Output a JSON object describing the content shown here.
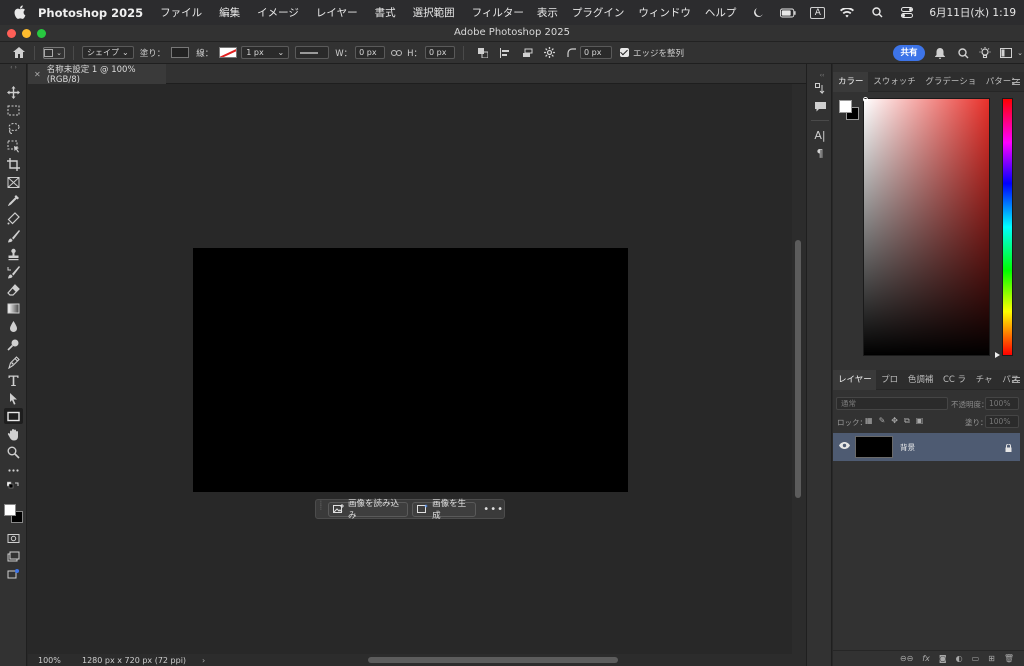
{
  "menubar": {
    "app_name": "Photoshop 2025",
    "menus": [
      "ファイル",
      "編集",
      "イメージ",
      "レイヤー",
      "書式",
      "選択範囲",
      "フィルター"
    ],
    "right_menus": [
      "表示",
      "プラグイン",
      "ウィンドウ",
      "ヘルプ"
    ],
    "input_indicator": "A",
    "datetime": "6月11日(水)  1:19"
  },
  "window": {
    "title": "Adobe Photoshop 2025"
  },
  "options_bar": {
    "mode": "シェイプ",
    "fill_label": "塗り：",
    "stroke_label": "線：",
    "stroke_width": "1 px",
    "w_label": "W：",
    "w_value": "0 px",
    "h_label": "H：",
    "h_value": "0 px",
    "radius_value": "0 px",
    "align_edges_label": "エッジを整列",
    "share_label": "共有"
  },
  "document": {
    "tab_label": "名称未設定 1 @ 100% (RGB/8)",
    "zoom": "100%",
    "dimensions": "1280 px x 720 px (72 ppi)"
  },
  "taskbar": {
    "import_label": "画像を読み込み",
    "generate_label": "画像を生成"
  },
  "color_panel": {
    "tabs": [
      "カラー",
      "スウォッチ",
      "グラデーショ",
      "パターン"
    ],
    "foreground": "#ffffff",
    "background": "#000000",
    "hue_color": "#e8302a"
  },
  "layers_panel": {
    "tabs": [
      "レイヤー",
      "プロ",
      "色調補",
      "CC ラ",
      "チャ",
      "パス"
    ],
    "blend_mode": "通常",
    "opacity_label": "不透明度：",
    "opacity_value": "100%",
    "lock_label": "ロック：",
    "fill_label": "塗り：",
    "fill_value": "100%",
    "layers": [
      {
        "name": "背景",
        "locked": true,
        "visible": true
      }
    ]
  },
  "colors": {
    "accent": "#3d74e8",
    "selected_layer": "#4e5b72"
  }
}
